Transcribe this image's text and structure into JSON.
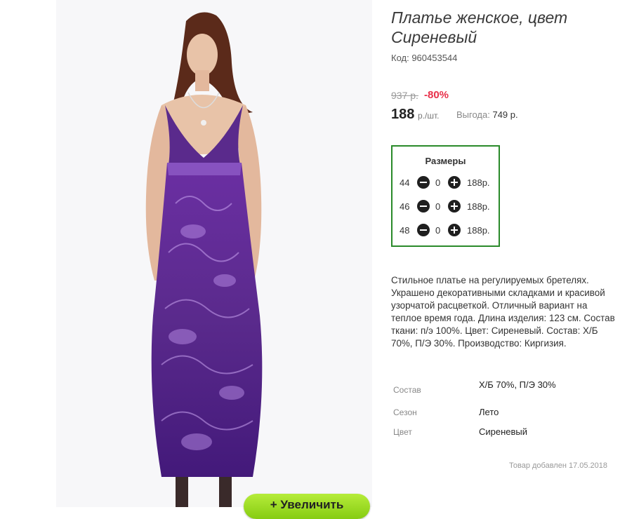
{
  "product": {
    "title": "Платье женское, цвет Сиреневый",
    "code": "Код: 960453544",
    "old_price": "937 р.",
    "discount": "-80%",
    "price": "188",
    "price_unit": "р./шт.",
    "saving_label": "Выгода:",
    "saving_value": "749 р.",
    "zoom_button": "+ Увеличить"
  },
  "sizes": {
    "title": "Размеры",
    "rows": [
      {
        "size": "44",
        "qty": "0",
        "price": "188р."
      },
      {
        "size": "46",
        "qty": "0",
        "price": "188р."
      },
      {
        "size": "48",
        "qty": "0",
        "price": "188р."
      }
    ]
  },
  "description": "Стильное платье на регулируемых бретелях. Украшено декоративными складками и красивой узорчатой расцветкой. Отличный вариант на теплое время года. Длина изделия: 123 см. Состав ткани: п/э 100%. Цвет: Сиреневый. Состав: Х/Б 70%, П/Э 30%. Производство: Киргизия.",
  "properties": [
    {
      "label": "Состав",
      "value": "Х/Б 70%, П/Э 30%"
    },
    {
      "label": "Сезон",
      "value": "Лето"
    },
    {
      "label": "Цвет",
      "value": "Сиреневый"
    }
  ],
  "added": "Товар добавлен 17.05.2018",
  "colors": {
    "accent_border": "#2a8a2a",
    "discount": "#e8304a",
    "button": "#9ad923",
    "dress": "#5a2a8c"
  },
  "icons": {
    "minus": "minus-circle-icon",
    "plus": "plus-circle-icon"
  }
}
